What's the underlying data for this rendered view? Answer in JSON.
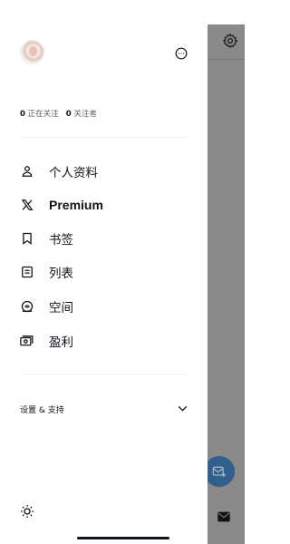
{
  "drawer": {
    "follow": {
      "following_count": "0",
      "following_label": "正在关注",
      "followers_count": "0",
      "followers_label": "关注者"
    },
    "nav_items": [
      {
        "icon": "person-icon",
        "label": "个人资料"
      },
      {
        "icon": "x-logo-icon",
        "label": "Premium"
      },
      {
        "icon": "bookmark-icon",
        "label": "书签"
      },
      {
        "icon": "list-icon",
        "label": "列表"
      },
      {
        "icon": "spaces-icon",
        "label": "空间"
      },
      {
        "icon": "monetization-icon",
        "label": "盈利"
      }
    ],
    "settings_label": "设置 & 支持"
  },
  "colors": {
    "text": "#0f1419",
    "divider": "#eff3f4",
    "overlay": "#8a8a8a",
    "fab": "#2f5f8a"
  }
}
